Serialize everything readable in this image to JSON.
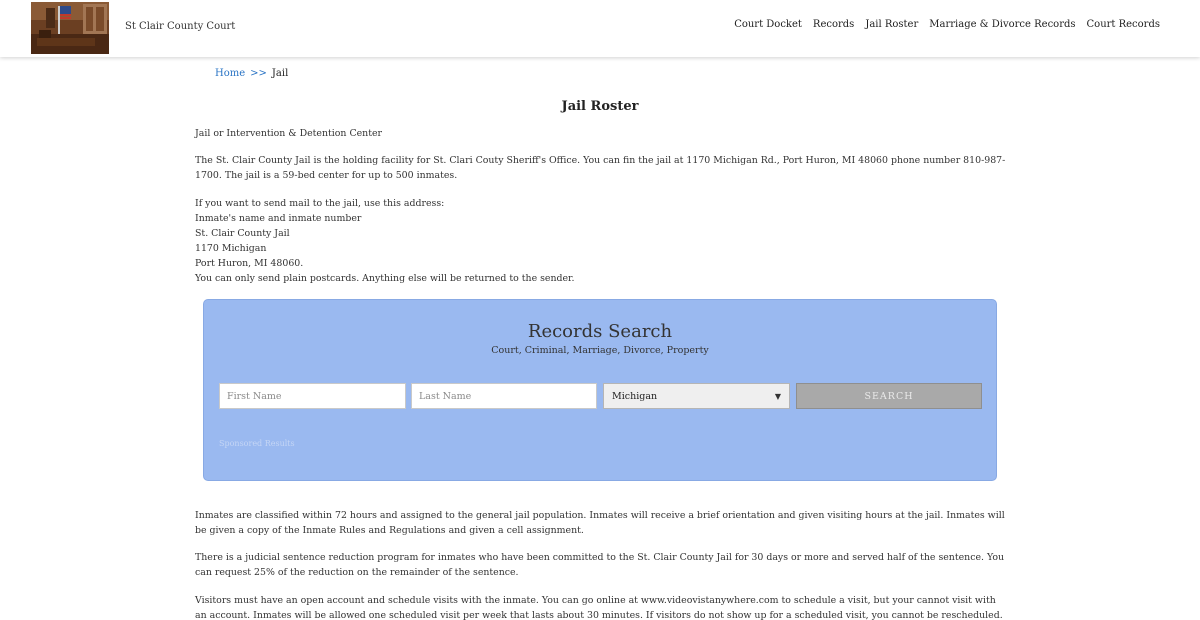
{
  "header": {
    "logo": "courtroom-photo",
    "site_title": "St Clair County Court",
    "nav": [
      "Court Docket",
      "Records",
      "Jail Roster",
      "Marriage & Divorce Records",
      "Court Records"
    ]
  },
  "breadcrumb": {
    "home": "Home",
    "separator": ">>",
    "current": "Jail"
  },
  "page_title": "Jail Roster",
  "intro": {
    "subheading": "Jail or Intervention & Detention Center",
    "description": "The St. Clair County Jail is the holding facility for St. Clari Couty Sheriff's Office. You can fin the jail at 1170 Michigan Rd., Port Huron, MI 48060 phone number 810-987-1700. The jail is a 59-bed center for up to 500 inmates.",
    "mail_lines": [
      "If you want to send mail to the jail, use this address:",
      "Inmate's name and inmate number",
      "St. Clair County Jail",
      "1170 Michigan",
      "Port Huron, MI 48060.",
      "You can only send plain postcards. Anything else will be returned to the sender."
    ]
  },
  "search": {
    "title": "Records Search",
    "subtitle": "Court, Criminal, Marriage, Divorce, Property",
    "first_name_placeholder": "First Name",
    "last_name_placeholder": "Last Name",
    "state_selected": "Michigan",
    "button_label": "SEARCH",
    "sponsored": "Sponsored Results",
    "colors": {
      "panel": "#9ab9f0",
      "button": "#a9a9a9"
    }
  },
  "body": {
    "classification": "Inmates are classified within 72 hours and assigned to the general jail population. Inmates will receive a brief orientation and given visiting hours at the jail. Inmates will be given a copy of the Inmate Rules and Regulations and given a cell assignment.",
    "reduction": "There is a judicial sentence reduction program for inmates who have been committed to the St. Clair County Jail for 30 days or more and served half of the sentence. You can request 25% of the reduction on the remainder of the sentence.",
    "visitors": "Visitors must have an open account and schedule visits with the inmate. You can go online at www.videovistanywhere.com to schedule a visit, but your cannot visit with an account. Inmates will be allowed one scheduled visit per week that lasts about 30 minutes. If visitors do not show up for a scheduled visit, you cannot be rescheduled. Three visitors will be allowed during"
  },
  "colors": {
    "link": "#2a74c5",
    "text": "#333333"
  }
}
